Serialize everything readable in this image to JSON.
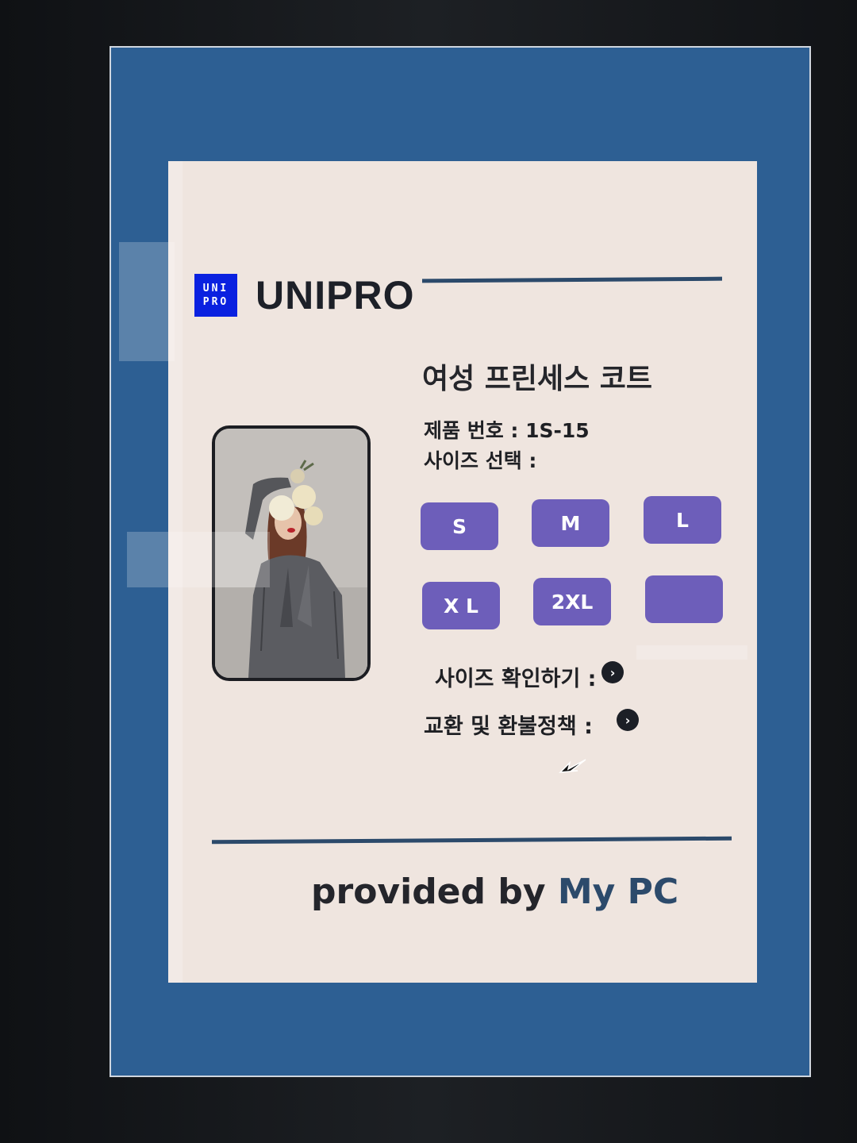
{
  "brand": {
    "logo_line1": "UNI",
    "logo_line2": "PRO",
    "name": "UNIPRO"
  },
  "product": {
    "title": "여성 프린세스 코트",
    "number_text": "제품 번호 : 1S-15",
    "size_label": "사이즈 선택 :",
    "sizes": [
      "S",
      "M",
      "L",
      "X L",
      "2XL",
      ""
    ]
  },
  "links": {
    "size_check": "사이즈 확인하기 :",
    "refund_policy": "교환 및 환불정책 :"
  },
  "footer": {
    "provided_by": "provided by",
    "provider": "My PC"
  },
  "colors": {
    "screen_background": "#2d5f93",
    "card_background": "#efe5df",
    "size_button": "#6d5eba",
    "logo": "#0a21e0",
    "rule": "#2c4a6b"
  }
}
